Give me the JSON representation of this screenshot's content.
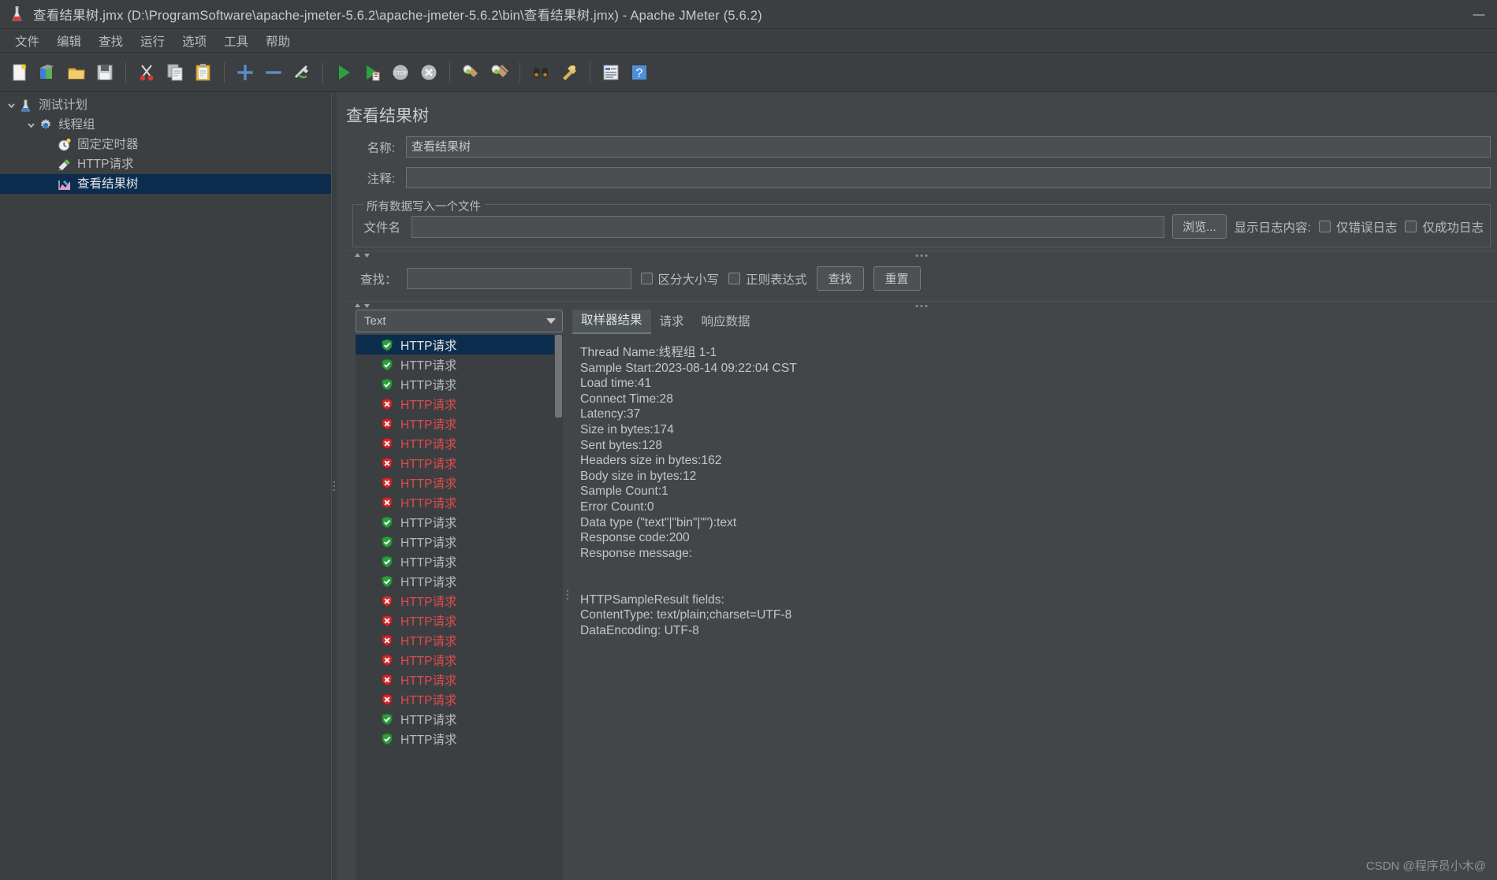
{
  "window": {
    "title": "查看结果树.jmx (D:\\ProgramSoftware\\apache-jmeter-5.6.2\\apache-jmeter-5.6.2\\bin\\查看结果树.jmx) - Apache JMeter (5.6.2)",
    "minimize_label": "—"
  },
  "menubar": {
    "items": [
      {
        "label": "文件",
        "name": "menu-file"
      },
      {
        "label": "编辑",
        "name": "menu-edit"
      },
      {
        "label": "查找",
        "name": "menu-search"
      },
      {
        "label": "运行",
        "name": "menu-run"
      },
      {
        "label": "选项",
        "name": "menu-options"
      },
      {
        "label": "工具",
        "name": "menu-tools"
      },
      {
        "label": "帮助",
        "name": "menu-help"
      }
    ]
  },
  "toolbar": {
    "buttons": [
      {
        "icon": "new-file-icon",
        "title": "新建"
      },
      {
        "icon": "templates-icon",
        "title": "模板"
      },
      {
        "icon": "open-folder-icon",
        "title": "打开"
      },
      {
        "icon": "save-icon",
        "title": "保存"
      },
      {
        "sep": true
      },
      {
        "icon": "cut-scissors-icon",
        "title": "剪切"
      },
      {
        "icon": "copy-icon",
        "title": "复制"
      },
      {
        "icon": "paste-clipboard-icon",
        "title": "粘贴"
      },
      {
        "sep": true
      },
      {
        "icon": "expand-plus-icon",
        "title": "展开全部"
      },
      {
        "icon": "collapse-minus-icon",
        "title": "收起全部"
      },
      {
        "icon": "toggle-pencil-icon",
        "title": "切换"
      },
      {
        "sep": true
      },
      {
        "icon": "run-play-icon",
        "title": "启动"
      },
      {
        "icon": "run-no-timers-icon",
        "title": "无间隔启动"
      },
      {
        "icon": "stop-icon",
        "title": "停止"
      },
      {
        "icon": "shutdown-icon",
        "title": "关闭"
      },
      {
        "sep": true
      },
      {
        "icon": "clear-brush-icon",
        "title": "清除"
      },
      {
        "icon": "clear-all-brush-icon",
        "title": "清除全部"
      },
      {
        "sep": true
      },
      {
        "icon": "binoculars-search-icon",
        "title": "查找"
      },
      {
        "icon": "clear-find-icon",
        "title": "清除查找"
      },
      {
        "sep": true
      },
      {
        "icon": "function-helper-icon",
        "title": "函数助手"
      },
      {
        "icon": "help-question-icon",
        "title": "帮助"
      }
    ]
  },
  "tree": {
    "nodes": [
      {
        "label": "测试计划",
        "icon": "test-plan-flask-icon",
        "depth": 0,
        "twisty": "expanded",
        "selected": false
      },
      {
        "label": "线程组",
        "icon": "thread-group-gear-icon",
        "depth": 1,
        "twisty": "expanded",
        "selected": false
      },
      {
        "label": "固定定时器",
        "icon": "timer-clock-icon",
        "depth": 2,
        "twisty": "none",
        "selected": false
      },
      {
        "label": "HTTP请求",
        "icon": "http-sampler-pipette-icon",
        "depth": 2,
        "twisty": "none",
        "selected": false
      },
      {
        "label": "查看结果树",
        "icon": "view-results-tree-icon",
        "depth": 2,
        "twisty": "none",
        "selected": true
      }
    ]
  },
  "panel": {
    "title": "查看结果树",
    "name_label": "名称:",
    "name_value": "查看结果树",
    "comment_label": "注释:",
    "comment_value": "",
    "group_title": "所有数据写入一个文件",
    "filename_label": "文件名",
    "filename_value": "",
    "browse_button": "浏览...",
    "log_display_label": "显示日志内容:",
    "errors_only_label": "仅错误日志",
    "success_only_label": "仅成功日志",
    "errors_only_checked": false,
    "success_only_checked": false
  },
  "search": {
    "label": "查找：",
    "value": "",
    "case_sensitive_label": "区分大小写",
    "case_sensitive_checked": false,
    "regex_label": "正则表达式",
    "regex_checked": false,
    "find_button": "查找",
    "reset_button": "重置"
  },
  "results": {
    "render_selected": "Text",
    "render_options": [
      "Text"
    ],
    "samplers": [
      {
        "label": "HTTP请求",
        "status": "ok",
        "selected": true
      },
      {
        "label": "HTTP请求",
        "status": "ok",
        "selected": false
      },
      {
        "label": "HTTP请求",
        "status": "ok",
        "selected": false
      },
      {
        "label": "HTTP请求",
        "status": "error",
        "selected": false
      },
      {
        "label": "HTTP请求",
        "status": "error",
        "selected": false
      },
      {
        "label": "HTTP请求",
        "status": "error",
        "selected": false
      },
      {
        "label": "HTTP请求",
        "status": "error",
        "selected": false
      },
      {
        "label": "HTTP请求",
        "status": "error",
        "selected": false
      },
      {
        "label": "HTTP请求",
        "status": "error",
        "selected": false
      },
      {
        "label": "HTTP请求",
        "status": "ok",
        "selected": false
      },
      {
        "label": "HTTP请求",
        "status": "ok",
        "selected": false
      },
      {
        "label": "HTTP请求",
        "status": "ok",
        "selected": false
      },
      {
        "label": "HTTP请求",
        "status": "ok",
        "selected": false
      },
      {
        "label": "HTTP请求",
        "status": "error",
        "selected": false
      },
      {
        "label": "HTTP请求",
        "status": "error",
        "selected": false
      },
      {
        "label": "HTTP请求",
        "status": "error",
        "selected": false
      },
      {
        "label": "HTTP请求",
        "status": "error",
        "selected": false
      },
      {
        "label": "HTTP请求",
        "status": "error",
        "selected": false
      },
      {
        "label": "HTTP请求",
        "status": "error",
        "selected": false
      },
      {
        "label": "HTTP请求",
        "status": "ok",
        "selected": false
      },
      {
        "label": "HTTP请求",
        "status": "ok",
        "selected": false
      }
    ],
    "tabs": [
      {
        "label": "取样器结果",
        "active": true
      },
      {
        "label": "请求",
        "active": false
      },
      {
        "label": "响应数据",
        "active": false
      }
    ],
    "detail_text": "Thread Name:线程组 1-1\nSample Start:2023-08-14 09:22:04 CST\nLoad time:41\nConnect Time:28\nLatency:37\nSize in bytes:174\nSent bytes:128\nHeaders size in bytes:162\nBody size in bytes:12\nSample Count:1\nError Count:0\nData type (\"text\"|\"bin\"|\"\"):text\nResponse code:200\nResponse message:\n\n\nHTTPSampleResult fields:\nContentType: text/plain;charset=UTF-8\nDataEncoding: UTF-8"
  },
  "watermark": "CSDN @程序员小木@",
  "colors": {
    "window_bg": "#3c3f41",
    "panel_bg": "#434649",
    "selection": "#0d2d4e",
    "text": "#b9bcbe",
    "error_text": "#e04a4a",
    "ok_green": "#34a14a"
  }
}
